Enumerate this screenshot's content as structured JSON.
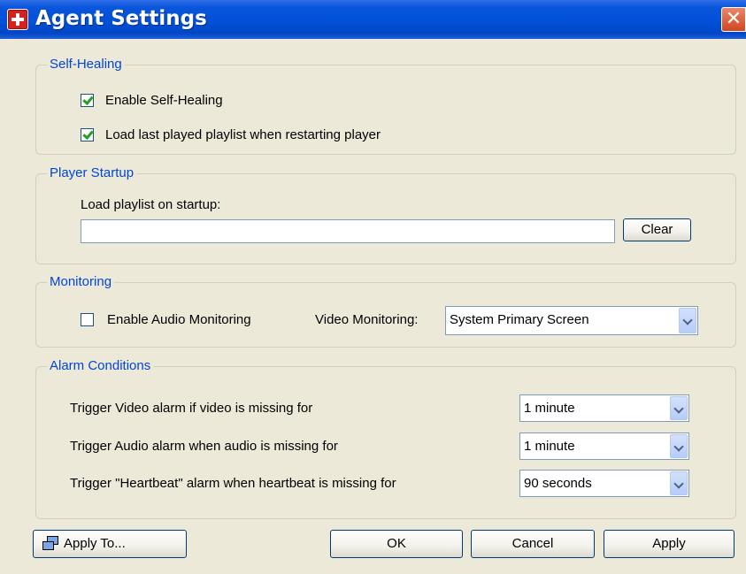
{
  "window": {
    "title": "Agent Settings",
    "icon": "app-icon",
    "close_label": "✕"
  },
  "self_healing": {
    "legend": "Self-Healing",
    "enable_label": "Enable Self-Healing",
    "enable_checked": true,
    "load_last_label": "Load last played playlist when restarting player",
    "load_last_checked": true
  },
  "player_startup": {
    "legend": "Player Startup",
    "playlist_label": "Load playlist on startup:",
    "playlist_value": "",
    "clear_label": "Clear"
  },
  "monitoring": {
    "legend": "Monitoring",
    "audio_label": "Enable Audio Monitoring",
    "audio_checked": false,
    "video_label": "Video Monitoring:",
    "video_value": "System Primary Screen"
  },
  "alarm_conditions": {
    "legend": "Alarm Conditions",
    "video_alarm_label": "Trigger Video alarm if video is missing for",
    "video_alarm_value": "1 minute",
    "audio_alarm_label": "Trigger Audio alarm when audio is missing for",
    "audio_alarm_value": "1 minute",
    "heartbeat_alarm_label": "Trigger \"Heartbeat\" alarm when heartbeat is missing for",
    "heartbeat_alarm_value": "90 seconds"
  },
  "footer": {
    "apply_to_label": "Apply To...",
    "ok_label": "OK",
    "cancel_label": "Cancel",
    "apply_label": "Apply"
  },
  "colors": {
    "titlebar": "#0050d8",
    "legend": "#0046d5",
    "dialog_bg": "#ece9d8"
  }
}
